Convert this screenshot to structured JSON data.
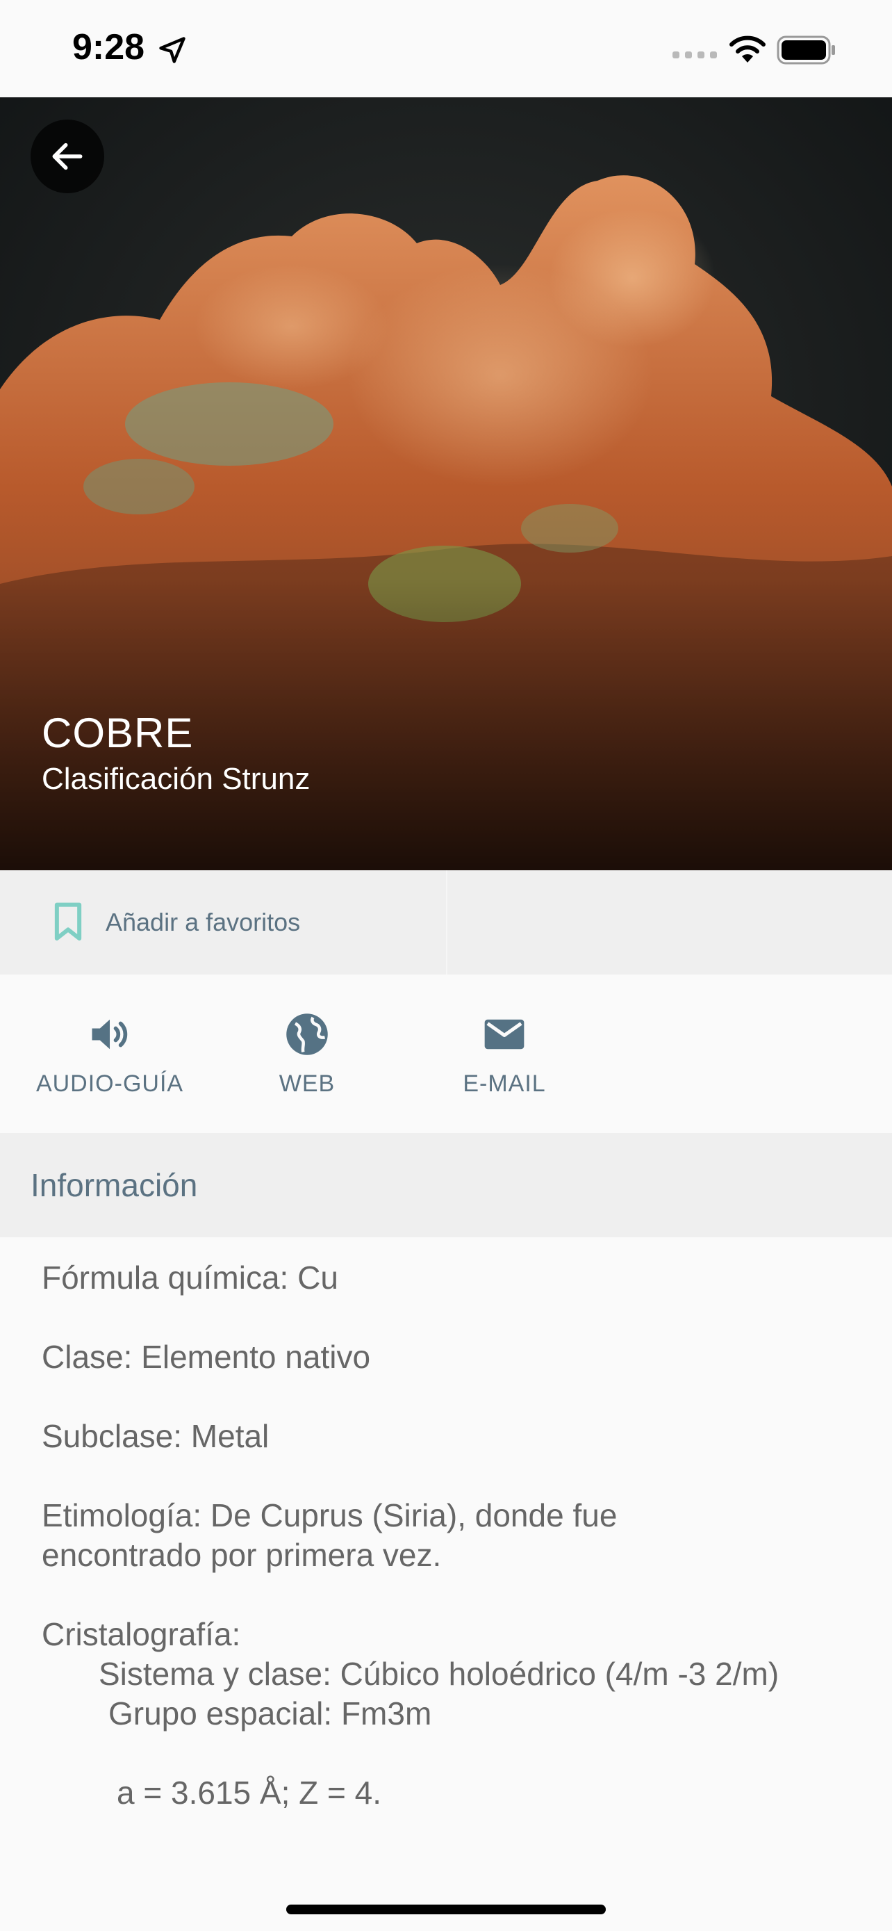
{
  "status_bar": {
    "time": "9:28"
  },
  "hero": {
    "title": "COBRE",
    "subtitle": "Clasificación Strunz",
    "back_icon": "arrow-left-icon"
  },
  "favorite": {
    "label": "Añadir a favoritos",
    "icon": "bookmark-icon"
  },
  "actions": [
    {
      "label": "AUDIO-GUÍA",
      "icon": "speaker-icon"
    },
    {
      "label": "WEB",
      "icon": "globe-icon"
    },
    {
      "label": "E-MAIL",
      "icon": "mail-icon"
    }
  ],
  "section": {
    "title": "Información"
  },
  "info": {
    "formula": "Fórmula química: Cu",
    "clase": "Clase: Elemento nativo",
    "subclase": "Subclase: Metal",
    "etimologia_line1": "Etimología: De Cuprus (Siria), donde fue",
    "etimologia_line2": "encontrado por primera vez.",
    "cristalografia": "Cristalografía:",
    "sistema": "Sistema y clase: Cúbico holoédrico (4/m -3 2/m)",
    "grupo": "Grupo espacial: Fm3m",
    "celda": "a = 3.615 Å; Z = 4."
  },
  "colors": {
    "accent_teal": "#7fcfc4",
    "label_slate": "#5b7282",
    "icon_slate": "#557284",
    "body_text": "#666666",
    "copper": "#c8683a"
  }
}
